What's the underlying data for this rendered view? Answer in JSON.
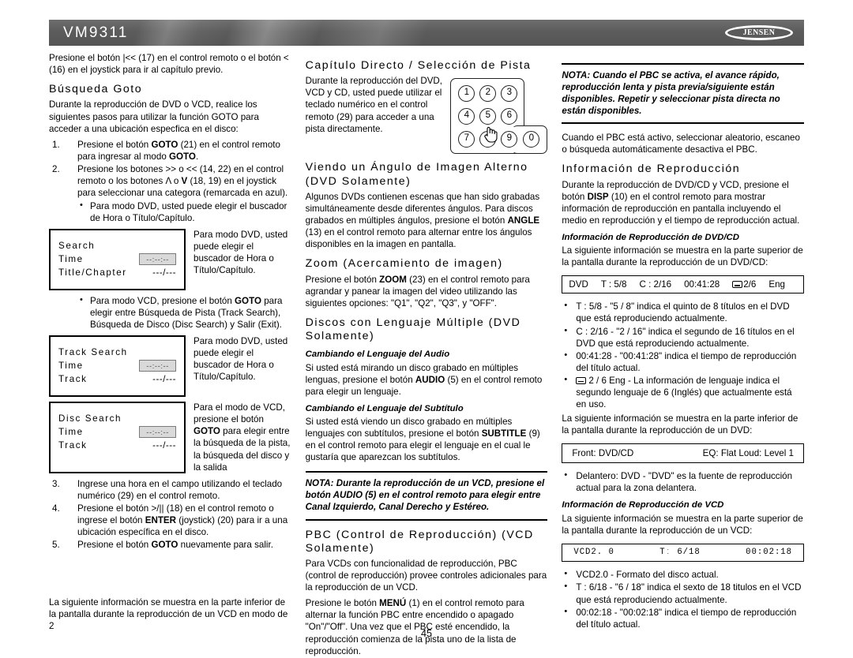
{
  "header": {
    "model": "VM9311",
    "brand": "JENSEN"
  },
  "page_number": "45",
  "col1": {
    "intro": "Presione el botón |<< (17) en el control remoto o el botón < (16) en el joystick para ir al capítulo previo.",
    "heading_goto": "Búsqueda Goto",
    "goto_intro": "Durante la reproducción de DVD o VCD, realice los siguientes pasos para utilizar la función GOTO para acceder a una ubicación especfica en el disco:",
    "steps": [
      {
        "num": "1.",
        "html": "Presione el botón <b>GOTO</b> (21) en el control remoto para ingresar al modo <b>GOTO</b>."
      },
      {
        "num": "2.",
        "html": "Presione los botones &gt;&gt; o &lt;&lt; (14, 22) en el control remoto o los botones Λ o <b>V</b> (18, 19) en el joystick para seleccionar una categora (remarcada en azul)."
      }
    ],
    "bullet_dvd_mode": "Para modo DVD, usted puede elegir el buscador de Hora o Título/Capítulo.",
    "osd_search": {
      "title": "Search",
      "row_time_label": "Time",
      "row_time_value": "--:--:--",
      "row_title_label": "Title/Chapter",
      "row_title_value": "---/---",
      "note": "Para modo DVD, usted puede elegir el buscador de Hora o Título/Capítulo."
    },
    "bullet_vcd_mode": "Para modo VCD, presione el botón <b>GOTO</b> para elegir entre Búsqueda de Pista (Track Search), Búsqueda de Disco (Disc Search) y Salir (Exit).",
    "osd_track": {
      "title": "Track Search",
      "row_time_label": "Time",
      "row_time_value": "--:--:--",
      "row_track_label": "Track",
      "row_track_value": "---/---",
      "note": "Para modo DVD, usted puede elegir el buscador de Hora o Título/Capítulo."
    },
    "osd_disc": {
      "title": "Disc Search",
      "row_time_label": "Time",
      "row_time_value": "--:--:--",
      "row_track_label": "Track",
      "row_track_value": "---/---",
      "note_html": "Para el modo de VCD, presione el botón <b>GOTO</b> para elegir entre la búsqueda de la pista, la búsqueda del disco y la salida"
    },
    "steps2": [
      {
        "num": "3.",
        "html": "Ingrese una hora en el campo utilizando el teclado numérico (29) en el control remoto."
      },
      {
        "num": "4.",
        "html": "Presione el botón &gt;/|| (18) en el control remoto o ingrese el botón <b>ENTER</b> (joystick) (20) para ir a una ubicación específica en el disco."
      },
      {
        "num": "5.",
        "html": "Presione el botón <b>GOTO</b> nuevamente para salir."
      }
    ],
    "closing": "La siguiente información se muestra en la parte inferior de la pantalla durante la reproducción de un VCD en modo de 2"
  },
  "col2": {
    "heading_direct": "Capítulo Directo /  Selección de Pista",
    "direct_body": "Durante la reproducción del DVD, VCD y CD, usted puede utilizar el teclado numérico en el control remoto (29) para acceder a una pista directamente.",
    "keypad_keys": [
      "1",
      "2",
      "3",
      "4",
      "5",
      "6",
      "7",
      "8",
      "9",
      "0"
    ],
    "heading_angle": "Viendo un Ángulo de Imagen Alterno (DVD Solamente)",
    "angle_body_html": "Algunos DVDs contienen escenas que han sido grabadas simultáneamente desde diferentes ángulos. Para discos grabados en múltiples ángulos, presione el botón <b>ANGLE</b> (13) en el control remoto para alternar entre los ángulos disponibles en la imagen en pantalla.",
    "heading_zoom": "Zoom (Acercamiento de imagen)",
    "zoom_body_html": "Presione el botón <b>ZOOM</b> (23) en el control remoto para agrandar y panear la imagen del video utilizando las siguientes opciones: \"Q1\", \"Q2\", \"Q3\", y \"OFF\".",
    "heading_multilang": "Discos con Lenguaje Múltiple (DVD Solamente)",
    "sub_audio": "Cambiando el Lenguaje del Audio",
    "audio_body_html": "Si usted está mirando un disco grabado en múltiples lenguas, presione el botón <b>AUDIO</b> (5) en el control remoto para elegir un lenguaje.",
    "sub_subtitle": "Cambiando el Lenguaje del Subtítulo",
    "subtitle_body_html": "Si usted está viendo un disco grabado en múltiples lenguajes con subtítulos, presione el botón <b>SUBTITLE</b> (9) en el control remoto para elegir el lenguaje en el cual le gustaría que aparezcan los subtítulos.",
    "note": "NOTA: Durante la reproducción de un VCD, presione el botón AUDIO (5) en el control remoto para elegir entre Canal Izquierdo, Canal Derecho y Estéreo.",
    "heading_pbc": "PBC (Control de Reproducción) (VCD Solamente)",
    "pbc_body": "Para VCDs con funcionalidad de reproducción, PBC (control de reproducción) provee controles adicionales para la reproducción de un VCD.",
    "pbc_body2_html": "Presione le botón <b>MENÚ</b> (1) en el control remoto para alternar la función PBC entre encendido o apagado \"On\"/\"Off\". Una vez que el PBC esté encendido, la reproducción comienza de la pista uno de la lista de reproducción."
  },
  "col3": {
    "note": "NOTA: Cuando el PBC se activa, el avance rápido, reproducción lenta y pista previa/siguiente están disponibles. Repetir y seleccionar pista directa no están disponibles.",
    "pbc_after": "Cuando el PBC está activo, seleccionar aleatorio, escaneo o búsqueda automáticamente desactiva el PBC.",
    "heading_info": "Información de Reproducción",
    "info_body_html": "Durante la reproducción de DVD/CD y VCD, presione el botón <b>DISP</b> (10) en el control remoto para mostrar información de reproducción en pantalla incluyendo el medio en reproducción y el tiempo de reproducción actual.",
    "sub_dvdcd": "Información de Reproducción de DVD/CD",
    "dvdcd_intro": "La siguiente información se muestra en la parte superior de la pantalla durante la reproducción de un DVD/CD:",
    "statusbar_dvd": {
      "media": "DVD",
      "title": "T : 5/8",
      "chapter": "C : 2/16",
      "time": "00:41:28",
      "subtitle": "2/6",
      "lang": "Eng"
    },
    "dvd_bullets": [
      "T : 5/8 - \"5 / 8\" indica el quinto de 8 títulos en el DVD que está reproduciendo actualmente.",
      "C : 2/16 - \"2 / 16\" indica el segundo de 16 títulos en el DVD que está reproduciendo actualmente.",
      "00:41:28 - \"00:41:28\" indica el tiempo de reproducción del título actual."
    ],
    "dvd_bullet_lang": "2 / 6 Eng - La información de lenguaje indica el segundo lenguaje de 6 (Inglés) que actualmente está en uso.",
    "dvd_bottom_intro": "La siguiente información se muestra en la parte inferior de la pantalla durante la reproducción de un DVD:",
    "statusbar_front": {
      "left": "Front:  DVD/CD",
      "right": "EQ:  Flat   Loud:  Level 1"
    },
    "front_bullet": "Delantero: DVD - \"DVD\" es la fuente de reproducción actual para la zona delantera.",
    "sub_vcd": "Información de Reproducción de VCD",
    "vcd_intro": "La siguiente información se muestra en la parte superior de la pantalla durante la reproducción de un VCD:",
    "statusbar_vcd": {
      "format": "VCD2. 0",
      "track": "Tː 6/18",
      "time": "00:02:18"
    },
    "vcd_bullets": [
      "VCD2.0 - Formato del disco actual.",
      "T : 6/18 - \"6 / 18\" indica el sexto de 18 titulos en el VCD que está reproduciendo actualmente.",
      "00:02:18 - \"00:02:18\" indica el tiempo de reproducción del título actual."
    ]
  }
}
